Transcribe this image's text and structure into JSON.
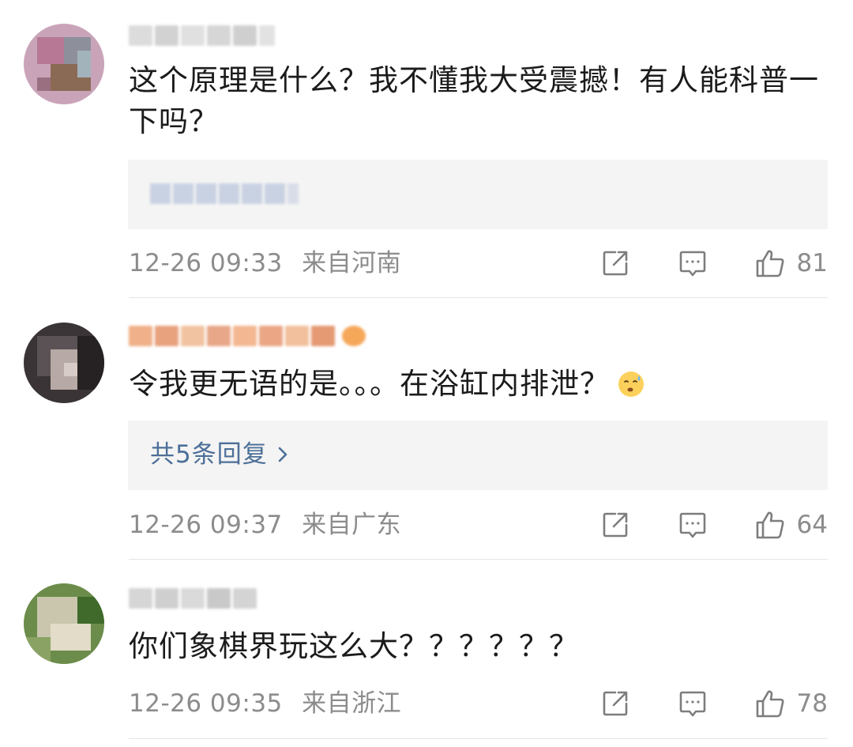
{
  "comments": [
    {
      "text": "这个原理是什么？我不懂我大受震撼！有人能科普一下吗？",
      "reply_label": "",
      "time": "12-26 09:33",
      "location": "来自河南",
      "likes": "81"
    },
    {
      "text": "令我更无语的是。。。在浴缸内排泄？",
      "reply_label": "共5条回复",
      "time": "12-26 09:37",
      "location": "来自广东",
      "likes": "64"
    },
    {
      "text": "你们象棋界玩这么大？？？？？？",
      "reply_label": "",
      "time": "12-26 09:35",
      "location": "来自浙江",
      "likes": "78"
    }
  ],
  "icons": {
    "share": "share-icon",
    "comment": "comment-icon",
    "like": "thumbs-up-icon",
    "chevron": "chevron-right-icon",
    "emoji": "sweat-face-emoji"
  },
  "colors": {
    "text": "#1b1b1b",
    "meta": "#8c8c8c",
    "link": "#4c6f98",
    "reply_bg": "#f4f4f4"
  }
}
